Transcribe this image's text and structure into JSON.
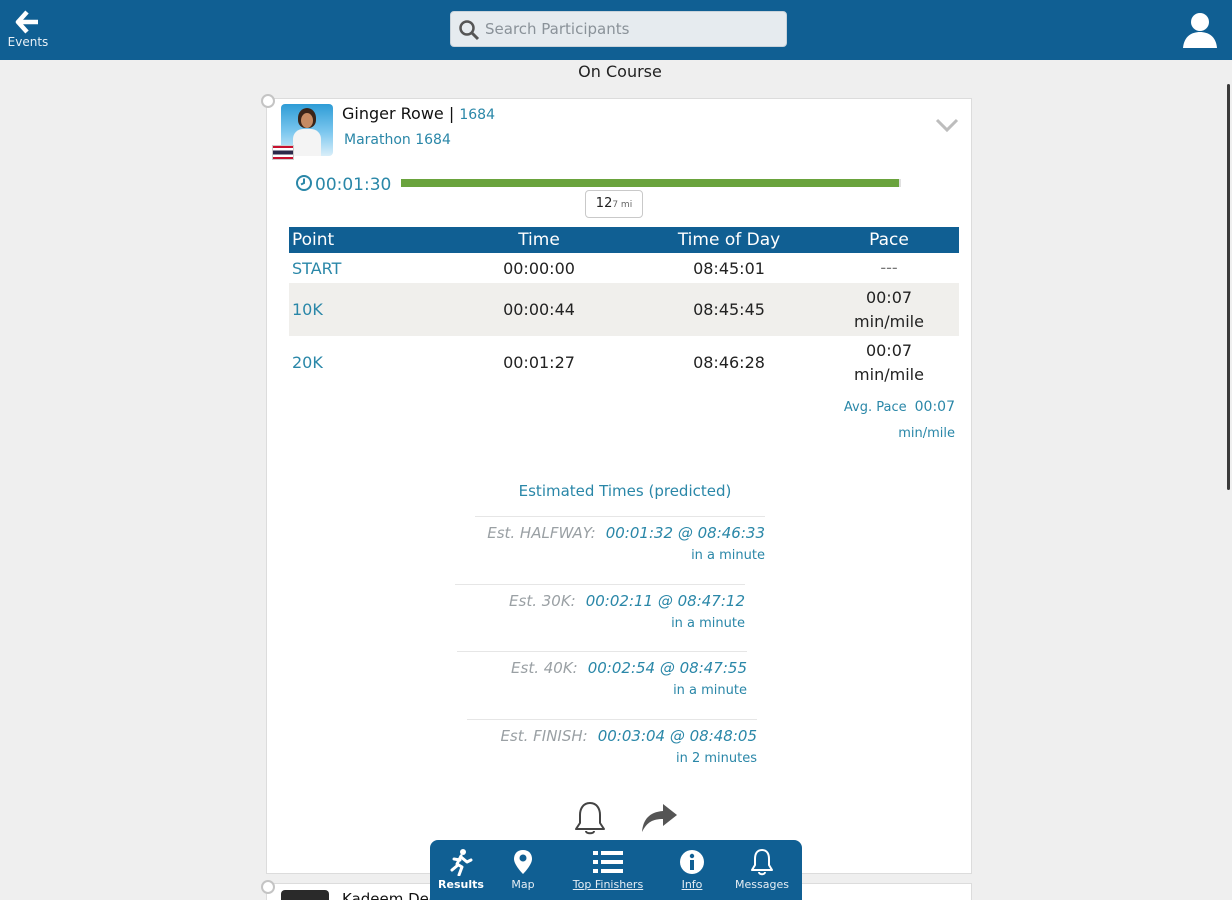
{
  "header": {
    "back_label": "Events",
    "search_placeholder": "Search Participants"
  },
  "page_title": "On Course",
  "participant": {
    "name": "Ginger Rowe",
    "separator": "|",
    "bib": "1684",
    "race": "Marathon 1684",
    "elapsed": "00:01:30",
    "progress_fraction": 0.995,
    "distance_value": "12",
    "distance_unit": "7 mi"
  },
  "splits": {
    "headers": [
      "Point",
      "Time",
      "Time of Day",
      "Pace"
    ],
    "rows": [
      {
        "point": "START",
        "time": "00:00:00",
        "tod": "08:45:01",
        "pace1": "---",
        "pace2": ""
      },
      {
        "point": "10K",
        "time": "00:00:44",
        "tod": "08:45:45",
        "pace1": "00:07",
        "pace2": "min/mile"
      },
      {
        "point": "20K",
        "time": "00:01:27",
        "tod": "08:46:28",
        "pace1": "00:07",
        "pace2": "min/mile"
      }
    ],
    "avg_label": "Avg. Pace",
    "avg_value": "00:07",
    "avg_unit": "min/mile"
  },
  "estimates": {
    "title": "Estimated Times (predicted)",
    "items": [
      {
        "label": "Est. HALFWAY:",
        "value": "00:01:32 @ 08:46:33",
        "relative": "in a minute"
      },
      {
        "label": "Est. 30K:",
        "value": "00:02:11 @ 08:47:12",
        "relative": "in a minute"
      },
      {
        "label": "Est. 40K:",
        "value": "00:02:54 @ 08:47:55",
        "relative": "in a minute"
      },
      {
        "label": "Est. FINISH:",
        "value": "00:03:04 @ 08:48:05",
        "relative": "in 2 minutes"
      }
    ]
  },
  "next_participant": {
    "name_partial": "Kadeem Dee"
  },
  "bottom_nav": {
    "items": [
      "Results",
      "Map",
      "Top Finishers",
      "Info",
      "Messages"
    ],
    "active": "Results"
  },
  "colors": {
    "primary": "#105f93",
    "accent_text": "#2a87a8",
    "progress": "#6aa33d"
  }
}
